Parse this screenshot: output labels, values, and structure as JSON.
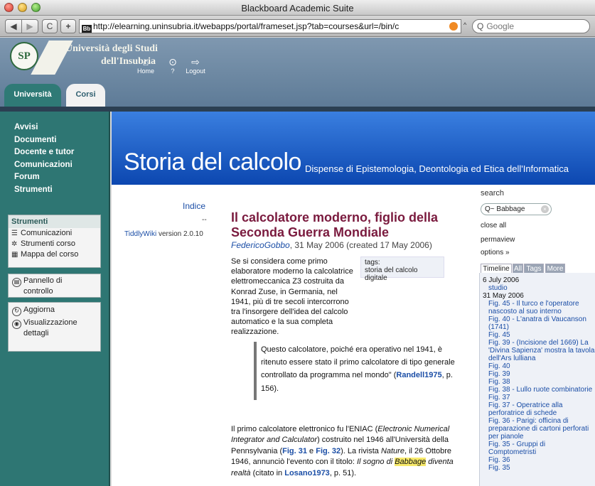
{
  "window": {
    "title": "Blackboard Academic Suite"
  },
  "toolbar": {
    "back_icon": "back-arrow",
    "forward_icon": "forward-arrow",
    "back_glyph": "◀",
    "forward_glyph": "▶",
    "reload_glyph": "C",
    "add_glyph": "+",
    "favicon_text": "Bb",
    "url": "http://elearning.uninsubria.it/webapps/portal/frameset.jsp?tab=courses&url=/bin/c",
    "search_placeholder": "Google",
    "search_glyph": "Q"
  },
  "portal": {
    "logo_mark": "SP",
    "university_line1": "Università degli Studi",
    "university_line2": "dell'Insubria",
    "nav": [
      {
        "label": "Home",
        "icon": "home-icon",
        "glyph": "⌂"
      },
      {
        "label": "?",
        "icon": "help-icon",
        "glyph": "⊙"
      },
      {
        "label": "Logout",
        "icon": "logout-icon",
        "glyph": "⇨"
      }
    ],
    "tabs": [
      {
        "label": "Università",
        "active": false
      },
      {
        "label": "Corsi",
        "active": true
      }
    ]
  },
  "sidebar": {
    "menu": [
      "Avvisi",
      "Documenti",
      "Docente e tutor",
      "Comunicazioni",
      "Forum",
      "Strumenti"
    ],
    "strumenti_box": {
      "heading": "Strumenti",
      "items": [
        {
          "label": "Comunicazioni",
          "glyph": "☰"
        },
        {
          "label": "Strumenti corso",
          "glyph": "✲"
        },
        {
          "label": "Mappa del corso",
          "glyph": "▦"
        }
      ]
    },
    "pannello": {
      "line1": "Pannello di",
      "line2": "controllo",
      "glyph": "▤"
    },
    "aggiorna": {
      "label": "Aggiorna",
      "glyph": "↻"
    },
    "visualizzazione": {
      "line1": "Visualizzazione",
      "line2": "dettagli",
      "glyph": "◉"
    }
  },
  "content": {
    "site_title": "Storia del calcolo",
    "site_subtitle": "Dispense di Epistemologia, Deontologia ed Etica dell'Informatica",
    "indice": "Indice",
    "dash": "--",
    "tiddlywiki_link": "TiddlyWiki",
    "tiddlywiki_version": "version 2.0.10",
    "tiddler": {
      "title": "Il calcolatore moderno, figlio della Seconda Guerra Mondiale",
      "author": "FedericoGobbo",
      "dates": ", 31 May 2006 (created 17 May 2006)",
      "tags_label": "tags:",
      "tag": "storia del calcolo digitale",
      "p1": "Se si considera come primo elaboratore moderno la calcolatrice elettromeccanica Z3 costruita da Konrad Zuse, in Germania, nel 1941, più di tre secoli intercorrono tra l'insorgere dell'idea del calcolo automatico e la sua completa realizzazione.",
      "quote_text": "Questo calcolatore, poiché era operativo nel 1941, è ritenuto essere stato il primo calcolatore di tipo generale controllato da programma nel mondo\" (",
      "quote_ref": "Randell1975",
      "quote_end": ", p. 156).",
      "p3_a": "Il primo calcolatore elettronico fu l'ENIAC (",
      "p3_eniac": "Electronic Numerical Integrator and Calculator",
      "p3_b": ") costruito nel 1946 all'Università della Pennsylvania (",
      "p3_fig31": "Fig. 31",
      "p3_e": " e ",
      "p3_fig32": "Fig. 32",
      "p3_c": "). La rivista ",
      "p3_nature": "Nature",
      "p3_d": ", il 26 Ottobre 1946, annunciò l'evento con il titolo: ",
      "p3_ital1": "Il sogno di ",
      "p3_babbage": "Babbage",
      "p3_ital2": " diventa realtà",
      "p3_f": " (citato in ",
      "p3_losano": "Losano1973",
      "p3_g": ", p. 51)."
    },
    "right": {
      "search_label": "search",
      "search_value": "Babbage",
      "search_glyph": "Q",
      "clear_glyph": "×",
      "close_all": "close all",
      "permaview": "permaview",
      "options": "options »",
      "tabs": [
        "Timeline",
        "All",
        "Tags",
        "More"
      ],
      "timeline": [
        {
          "type": "date",
          "text": "6 July 2006"
        },
        {
          "type": "item",
          "text": "studio"
        },
        {
          "type": "date",
          "text": "31 May 2006"
        },
        {
          "type": "item",
          "text": "Fig. 45 - Il turco e l'operatore nascosto al suo interno"
        },
        {
          "type": "item",
          "text": "Fig. 40 - L'anatra di Vaucanson (1741)"
        },
        {
          "type": "item",
          "text": "Fig. 45"
        },
        {
          "type": "item",
          "text": "Fig. 39 - (Incisione del 1669) La 'Divina Sapienza' mostra la tavola dell'Ars lulliana"
        },
        {
          "type": "item",
          "text": "Fig. 40"
        },
        {
          "type": "item",
          "text": "Fig. 39"
        },
        {
          "type": "item",
          "text": "Fig. 38"
        },
        {
          "type": "item",
          "text": "Fig. 38 - Lullo ruote combinatorie"
        },
        {
          "type": "item",
          "text": "Fig. 37"
        },
        {
          "type": "item",
          "text": "Fig. 37 - Operatrice alla perforatrice di schede"
        },
        {
          "type": "item",
          "text": "Fig. 36 - Parigi: officina di preparazione di cartoni perforati per pianole"
        },
        {
          "type": "item",
          "text": "Fig. 35 - Gruppi di Comptometristi"
        },
        {
          "type": "item",
          "text": "Fig. 36"
        },
        {
          "type": "item",
          "text": "Fig. 35"
        }
      ]
    }
  }
}
